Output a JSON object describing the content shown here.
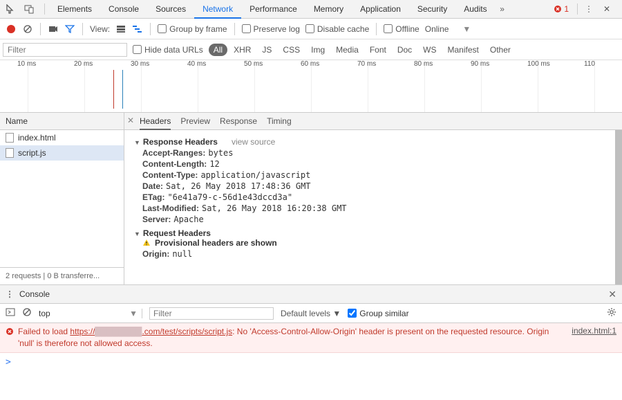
{
  "topTabs": [
    "Elements",
    "Console",
    "Sources",
    "Network",
    "Performance",
    "Memory",
    "Application",
    "Security",
    "Audits"
  ],
  "activeTopTab": 3,
  "errorBadge": "1",
  "toolbar": {
    "viewLabel": "View:",
    "groupByFrame": "Group by frame",
    "preserveLog": "Preserve log",
    "disableCache": "Disable cache",
    "offline": "Offline",
    "online": "Online"
  },
  "filterRow": {
    "placeholder": "Filter",
    "hideDataUrls": "Hide data URLs",
    "types": [
      "All",
      "XHR",
      "JS",
      "CSS",
      "Img",
      "Media",
      "Font",
      "Doc",
      "WS",
      "Manifest",
      "Other"
    ],
    "activeType": 0
  },
  "timeline": {
    "ticks": [
      "10 ms",
      "20 ms",
      "30 ms",
      "40 ms",
      "50 ms",
      "60 ms",
      "70 ms",
      "80 ms",
      "90 ms",
      "100 ms",
      "110"
    ]
  },
  "requests": {
    "header": "Name",
    "items": [
      "index.html",
      "script.js"
    ],
    "selected": 1,
    "status": "2 requests  |  0 B transferre..."
  },
  "detail": {
    "tabs": [
      "Headers",
      "Preview",
      "Response",
      "Timing"
    ],
    "activeTab": 0,
    "responseHeadersTitle": "Response Headers",
    "viewSource": "view source",
    "responseHeaders": [
      {
        "k": "Accept-Ranges:",
        "v": "bytes"
      },
      {
        "k": "Content-Length:",
        "v": "12"
      },
      {
        "k": "Content-Type:",
        "v": "application/javascript"
      },
      {
        "k": "Date:",
        "v": "Sat, 26 May 2018 17:48:36 GMT"
      },
      {
        "k": "ETag:",
        "v": "\"6e41a79-c-56d1e43dccd3a\""
      },
      {
        "k": "Last-Modified:",
        "v": "Sat, 26 May 2018 16:20:38 GMT"
      },
      {
        "k": "Server:",
        "v": "Apache"
      }
    ],
    "requestHeadersTitle": "Request Headers",
    "provisional": "Provisional headers are shown",
    "requestHeaders": [
      {
        "k": "Origin:",
        "v": "null"
      }
    ]
  },
  "console": {
    "title": "Console",
    "context": "top",
    "filterPlaceholder": "Filter",
    "levels": "Default levels ▼",
    "groupSimilar": "Group similar",
    "error": {
      "prefix": "Failed to load ",
      "urlPre": "https://",
      "urlRedacted": "████████",
      "urlPost": ".com/test/scripts/script.js",
      "rest": ": No 'Access-Control-Allow-Origin' header is present on the requested resource. Origin 'null' is therefore not allowed access.",
      "source": "index.html:1"
    },
    "prompt": ">"
  }
}
